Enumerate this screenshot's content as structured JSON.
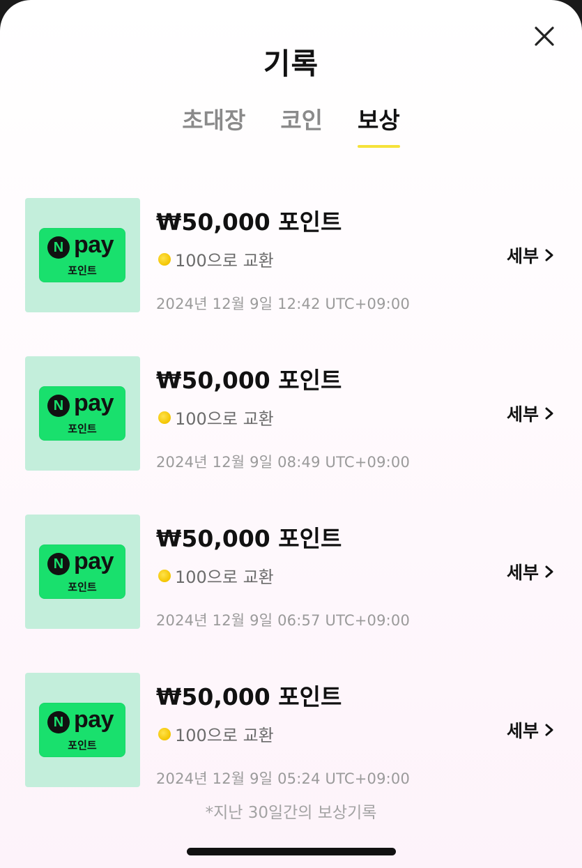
{
  "header": {
    "title": "기록",
    "close_icon": "close-icon"
  },
  "tabs": [
    {
      "label": "초대장",
      "active": false
    },
    {
      "label": "코인",
      "active": false
    },
    {
      "label": "보상",
      "active": true
    }
  ],
  "colors": {
    "accent_underline": "#f5e23a",
    "npay_green": "#19e06d",
    "thumb_bg": "#c3eedb",
    "coin": "#f3c400"
  },
  "rewards": [
    {
      "title": "₩50,000 포인트",
      "badge_logo": "N",
      "badge_pay": "pay",
      "badge_sub": "포인트",
      "exchange_text": "100으로 교환",
      "coin_icon": "coin-icon",
      "date": "2024년 12월 9일 12:42 UTC+09:00",
      "detail_label": "세부"
    },
    {
      "title": "₩50,000 포인트",
      "badge_logo": "N",
      "badge_pay": "pay",
      "badge_sub": "포인트",
      "exchange_text": "100으로 교환",
      "coin_icon": "coin-icon",
      "date": "2024년 12월 9일 08:49 UTC+09:00",
      "detail_label": "세부"
    },
    {
      "title": "₩50,000 포인트",
      "badge_logo": "N",
      "badge_pay": "pay",
      "badge_sub": "포인트",
      "exchange_text": "100으로 교환",
      "coin_icon": "coin-icon",
      "date": "2024년 12월 9일 06:57 UTC+09:00",
      "detail_label": "세부"
    },
    {
      "title": "₩50,000 포인트",
      "badge_logo": "N",
      "badge_pay": "pay",
      "badge_sub": "포인트",
      "exchange_text": "100으로 교환",
      "coin_icon": "coin-icon",
      "date": "2024년 12월 9일 05:24 UTC+09:00",
      "detail_label": "세부"
    }
  ],
  "footnote": "*지난 30일간의 보상기록"
}
